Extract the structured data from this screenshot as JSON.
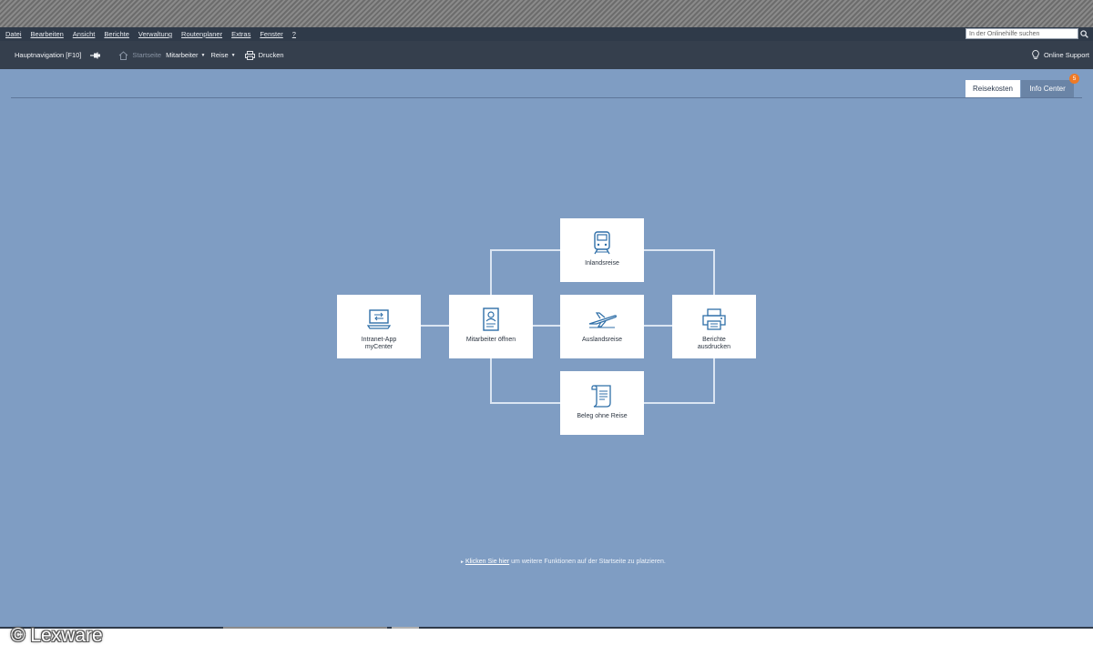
{
  "menubar": {
    "items": [
      "Datei",
      "Bearbeiten",
      "Ansicht",
      "Berichte",
      "Verwaltung",
      "Routenplaner",
      "Extras",
      "Fenster",
      "?"
    ]
  },
  "help_search": {
    "placeholder": "In der Onlinehilfe suchen"
  },
  "toolbar": {
    "main_nav": "Hauptnavigation [F10]",
    "home": "Startseite",
    "employee": "Mitarbeiter",
    "trip": "Reise",
    "print": "Drucken",
    "support": "Online Support"
  },
  "tabs": {
    "reisekosten": "Reisekosten",
    "info_center": "Info Center",
    "info_badge": "5"
  },
  "tiles": {
    "intranet": {
      "label": "Intranet-App\nmyCenter",
      "icon": "laptop-sync-icon"
    },
    "mitarbeiter": {
      "label": "Mitarbeiter öffnen",
      "icon": "id-card-icon"
    },
    "inland": {
      "label": "Inlandsreise",
      "icon": "train-icon"
    },
    "ausland": {
      "label": "Auslandsreise",
      "icon": "airplane-icon"
    },
    "beleg": {
      "label": "Beleg ohne Reise",
      "icon": "receipt-scroll-icon"
    },
    "berichte": {
      "label": "Berichte\nausdrucken",
      "icon": "printer-icon"
    }
  },
  "hint": {
    "link": "Klicken Sie hier",
    "rest": " um weitere Funktionen auf der Startseite zu platzieren."
  },
  "footer": {
    "copyright": "© Lexware"
  },
  "colors": {
    "background": "#7f9dc3",
    "menubar": "#2f3a49",
    "toolbar": "#353f4d",
    "badge": "#ee7a26",
    "icon_blue": "#2f6fa8"
  }
}
